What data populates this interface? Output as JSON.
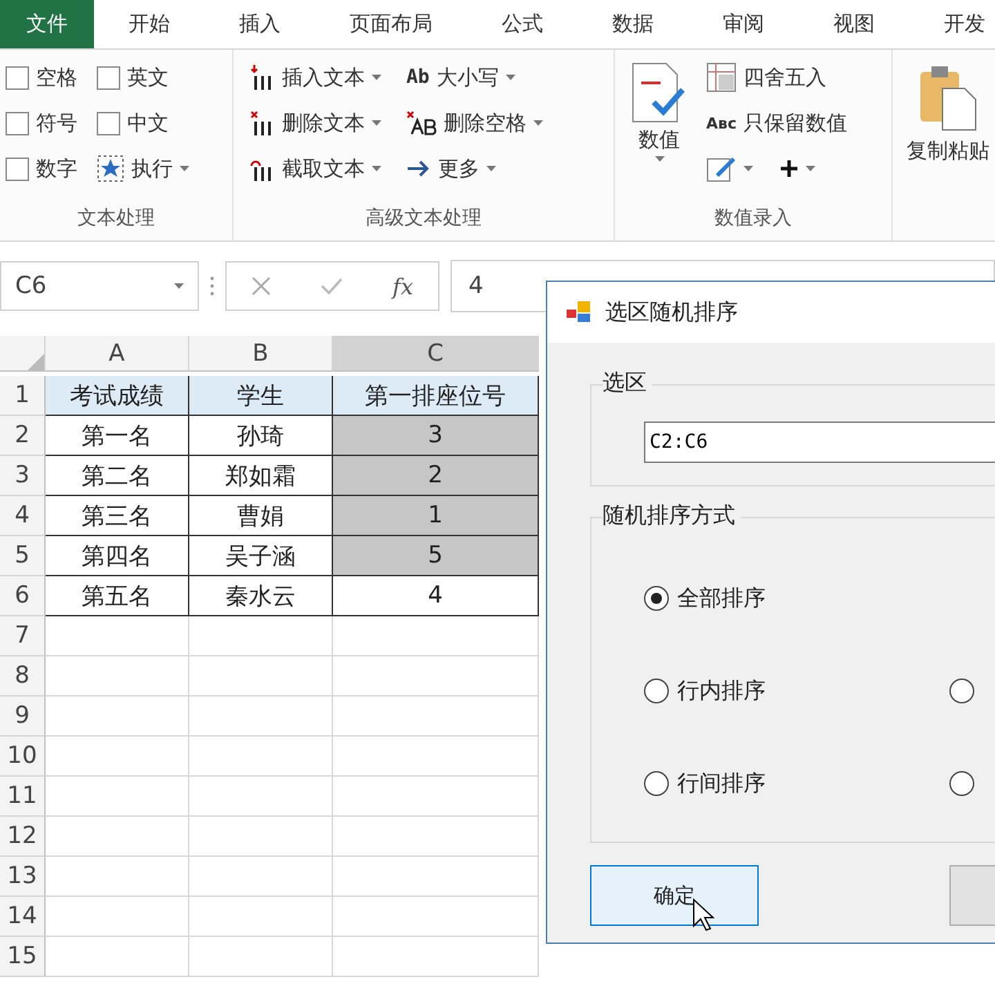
{
  "menu_tabs": [
    {
      "label": "文件",
      "selected": true
    },
    {
      "label": "开始",
      "selected": false
    },
    {
      "label": "插入",
      "selected": false
    },
    {
      "label": "页面布局",
      "selected": false
    },
    {
      "label": "公式",
      "selected": false
    },
    {
      "label": "数据",
      "selected": false
    },
    {
      "label": "审阅",
      "selected": false
    },
    {
      "label": "视图",
      "selected": false
    },
    {
      "label": "开发",
      "selected": false
    }
  ],
  "ribbon": {
    "text_group": {
      "label": "文本处理",
      "checkboxes": [
        {
          "label": "空格",
          "checked": false
        },
        {
          "label": "英文",
          "checked": false
        },
        {
          "label": "符号",
          "checked": false
        },
        {
          "label": "中文",
          "checked": false
        },
        {
          "label": "数字",
          "checked": false
        }
      ],
      "run_button": "执行"
    },
    "advanced_group": {
      "label": "高级文本处理",
      "items": [
        {
          "label": "插入文本",
          "kind": "insert"
        },
        {
          "label": "大小写",
          "kind": "case",
          "icon_text": "Ab"
        },
        {
          "label": "删除文本",
          "kind": "delete"
        },
        {
          "label": "删除空格",
          "kind": "trim"
        },
        {
          "label": "截取文本",
          "kind": "cut"
        },
        {
          "label": "更多",
          "kind": "more"
        }
      ]
    },
    "number_group": {
      "label": "数值录入",
      "big_button": "数值",
      "items": [
        "四舍五入",
        "只保留数值"
      ],
      "abc_icon_text": "Aʙᴄ"
    },
    "clipboard_group": {
      "big_button": "复制粘贴"
    }
  },
  "formula_bar": {
    "name_box": "C6",
    "fx_label": "fx",
    "formula": "4"
  },
  "sheet": {
    "columns": [
      {
        "label": "A",
        "selected": false
      },
      {
        "label": "B",
        "selected": false
      },
      {
        "label": "C",
        "selected": true
      }
    ],
    "rows": [
      {
        "number": "1",
        "kind": "header",
        "cells": [
          {
            "text": "考试成绩",
            "selected": false
          },
          {
            "text": "学生",
            "selected": false
          },
          {
            "text": "第一排座位号",
            "selected": false
          }
        ]
      },
      {
        "number": "2",
        "kind": "data",
        "cells": [
          {
            "text": "第一名",
            "selected": false
          },
          {
            "text": "孙琦",
            "selected": false
          },
          {
            "text": "3",
            "selected": true
          }
        ]
      },
      {
        "number": "3",
        "kind": "data",
        "cells": [
          {
            "text": "第二名",
            "selected": false
          },
          {
            "text": "郑如霜",
            "selected": false
          },
          {
            "text": "2",
            "selected": true
          }
        ]
      },
      {
        "number": "4",
        "kind": "data",
        "cells": [
          {
            "text": "第三名",
            "selected": false
          },
          {
            "text": "曹娟",
            "selected": false
          },
          {
            "text": "1",
            "selected": true
          }
        ]
      },
      {
        "number": "5",
        "kind": "data",
        "cells": [
          {
            "text": "第四名",
            "selected": false
          },
          {
            "text": "吴子涵",
            "selected": false
          },
          {
            "text": "5",
            "selected": true
          }
        ]
      },
      {
        "number": "6",
        "kind": "data",
        "cells": [
          {
            "text": "第五名",
            "selected": false
          },
          {
            "text": "秦水云",
            "selected": false
          },
          {
            "text": "4",
            "selected": false
          }
        ]
      },
      {
        "number": "7",
        "kind": "empty"
      },
      {
        "number": "8",
        "kind": "empty"
      },
      {
        "number": "9",
        "kind": "empty"
      },
      {
        "number": "10",
        "kind": "empty"
      },
      {
        "number": "11",
        "kind": "empty"
      },
      {
        "number": "12",
        "kind": "empty"
      },
      {
        "number": "13",
        "kind": "empty"
      },
      {
        "number": "14",
        "kind": "empty"
      },
      {
        "number": "15",
        "kind": "empty"
      }
    ]
  },
  "dialog": {
    "title": "选区随机排序",
    "range_group": {
      "label": "选区",
      "value": "C2:C6"
    },
    "mode_group": {
      "label": "随机排序方式",
      "options": [
        {
          "label": "全部排序",
          "selected": true
        },
        {
          "label": "行内排序",
          "selected": false
        },
        {
          "selected": false
        },
        {
          "label": "行间排序",
          "selected": false
        },
        {
          "selected": false
        }
      ]
    },
    "buttons": [
      {
        "label": "确定",
        "focused": true
      },
      {
        "focused": false
      }
    ]
  }
}
